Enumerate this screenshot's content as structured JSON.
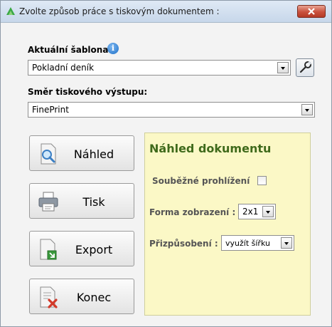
{
  "window": {
    "title": "Zvolte způsob práce s tiskovým dokumentem :"
  },
  "template": {
    "label": "Aktuální šablona",
    "value": "Pokladní deník"
  },
  "output": {
    "label": "Směr tiskového výstupu:",
    "value": "FinePrint"
  },
  "buttons": {
    "preview": "Náhled",
    "print": "Tisk",
    "export": "Export",
    "exit": "Konec"
  },
  "preview_panel": {
    "title": "Náhled dokumentu",
    "concurrent_label": "Souběžné prohlížení",
    "concurrent_checked": false,
    "display_form_label": "Forma zobrazení :",
    "display_form_value": "2x1",
    "fit_label": "Přizpůsobení :",
    "fit_value": "využít šířku"
  },
  "colors": {
    "panel_bg": "#fbf8c6",
    "panel_title": "#3f6a1b",
    "close": "#c9503c"
  },
  "icons": [
    "app-icon",
    "close-icon",
    "info-icon",
    "wrench-icon",
    "magnifier-doc-icon",
    "printer-icon",
    "export-doc-icon",
    "close-doc-icon"
  ]
}
